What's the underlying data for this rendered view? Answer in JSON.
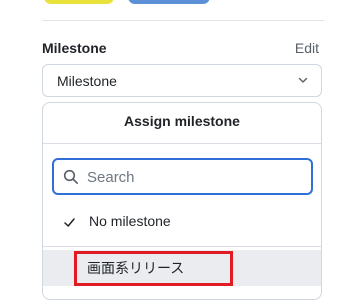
{
  "milestone": {
    "section_title": "Milestone",
    "edit_label": "Edit",
    "select_value": "Milestone",
    "dropdown": {
      "header": "Assign milestone",
      "search_placeholder": "Search",
      "search_value": "",
      "options": [
        {
          "label": "No milestone",
          "selected": true
        },
        {
          "label": "画面系リリース",
          "selected": false,
          "highlighted": true
        }
      ]
    }
  },
  "colors": {
    "focus_border": "#2f6fd6",
    "annotation_red": "#e01b24",
    "chip_yellow": "#e9e23a",
    "chip_blue": "#5b8fd6",
    "hover_row": "#eaecef"
  }
}
